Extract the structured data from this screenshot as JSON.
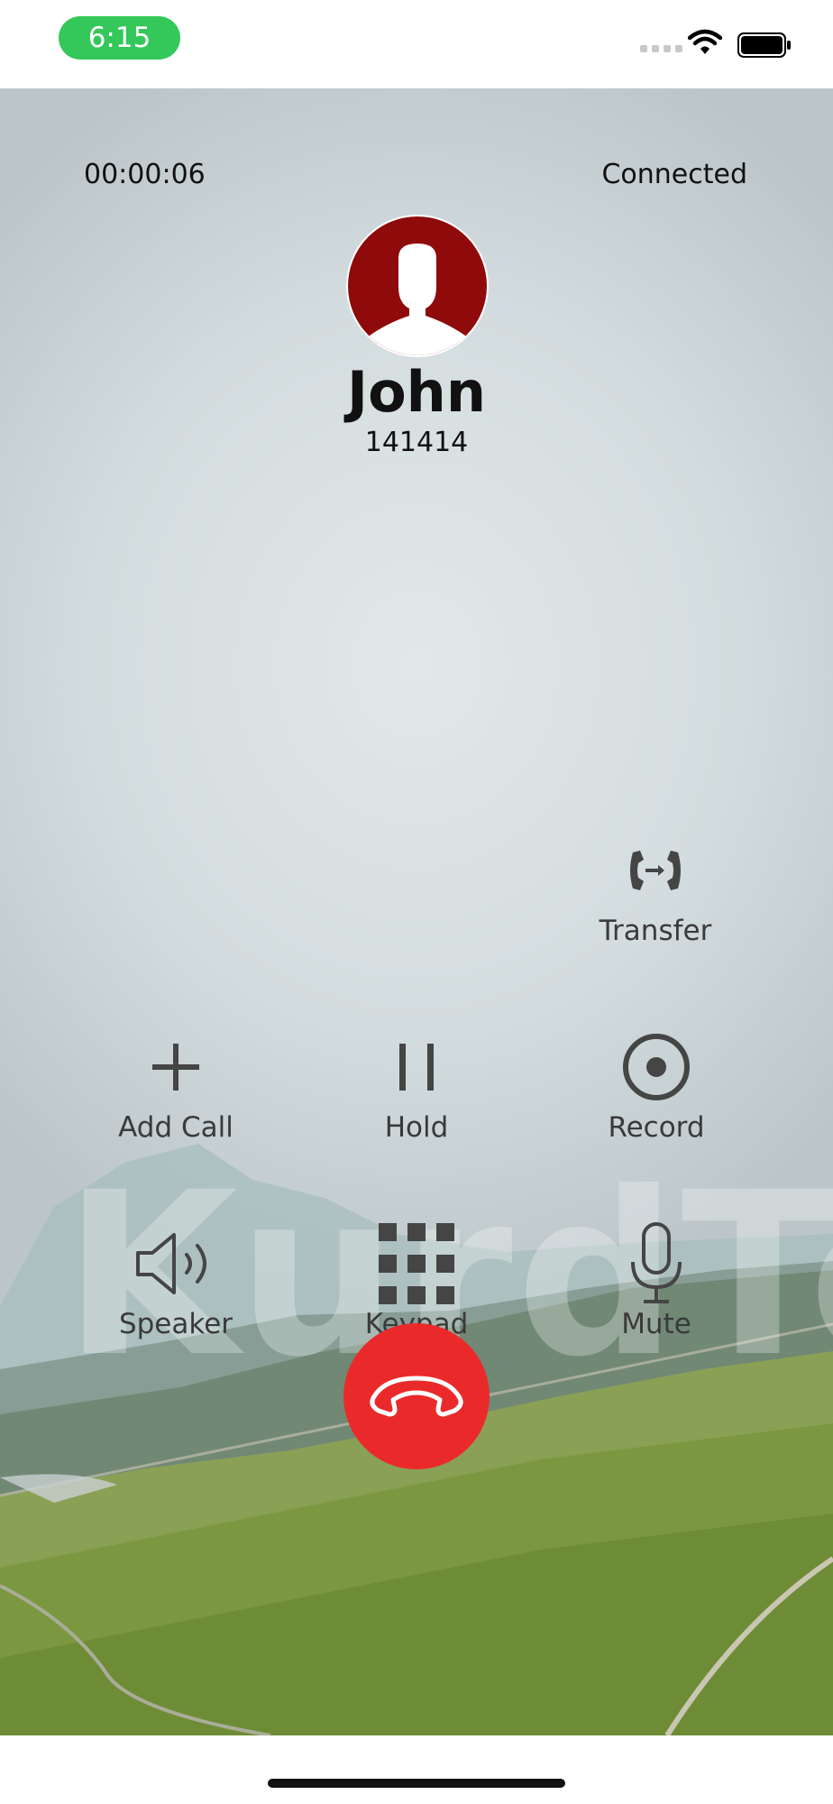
{
  "status_bar": {
    "time": "6:15"
  },
  "call": {
    "duration": "00:00:06",
    "status": "Connected",
    "contact_name": "John",
    "contact_number": "141414"
  },
  "actions": {
    "transfer": "Transfer",
    "add_call": "Add Call",
    "hold": "Hold",
    "record": "Record",
    "speaker": "Speaker",
    "keypad": "Keypad",
    "mute": "Mute"
  },
  "background": {
    "watermark": "KurdTel"
  },
  "colors": {
    "end_call": "#ea2a2a",
    "avatar": "#8f0a0a",
    "time_pill": "#34c759"
  }
}
